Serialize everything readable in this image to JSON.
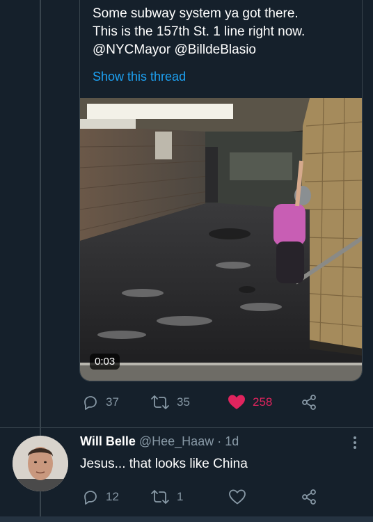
{
  "quoted_tweet": {
    "text": "Some subway system ya got there.\nThis is the 157th St. 1 line right now.\n@NYCMayor @BilldeBlasio",
    "show_thread": "Show this thread",
    "video_duration": "0:03"
  },
  "tweet_actions": {
    "replies": "37",
    "retweets": "35",
    "likes": "258",
    "liked": true,
    "like_color": "#e0245e",
    "icon_color": "#8899a6"
  },
  "reply": {
    "name": "Will Belle",
    "handle": "@Hee_Haaw",
    "time": "1d",
    "text": "Jesus... that looks like China",
    "replies": "12",
    "retweets": "1",
    "likes": ""
  },
  "colors": {
    "background": "#15202b",
    "link": "#1da1f2",
    "border": "#38444d"
  }
}
